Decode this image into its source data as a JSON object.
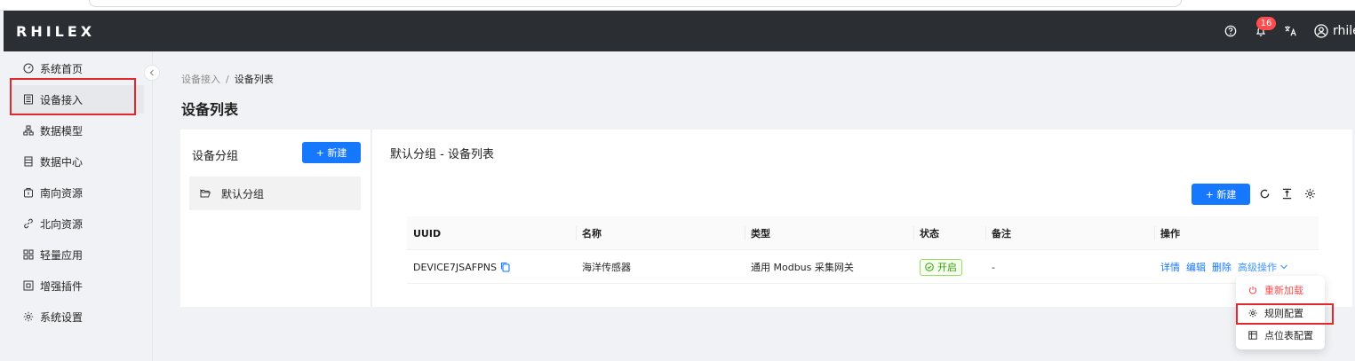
{
  "app": {
    "logo": "RHILEX",
    "notification_count": "16",
    "user": "rhile"
  },
  "sidebar": {
    "items": [
      {
        "label": "系统首页",
        "icon": "dashboard-icon"
      },
      {
        "label": "设备接入",
        "icon": "device-icon",
        "active": true
      },
      {
        "label": "数据模型",
        "icon": "model-icon"
      },
      {
        "label": "数据中心",
        "icon": "database-icon"
      },
      {
        "label": "南向资源",
        "icon": "south-resource-icon"
      },
      {
        "label": "北向资源",
        "icon": "north-resource-icon"
      },
      {
        "label": "轻量应用",
        "icon": "app-icon"
      },
      {
        "label": "增强插件",
        "icon": "plugin-icon"
      },
      {
        "label": "系统设置",
        "icon": "settings-icon"
      }
    ]
  },
  "breadcrumb": {
    "parent": "设备接入",
    "separator": "/",
    "current": "设备列表"
  },
  "page": {
    "title": "设备列表"
  },
  "groups": {
    "title": "设备分组",
    "new_label": "+ 新建",
    "items": [
      {
        "label": "默认分组"
      }
    ]
  },
  "list": {
    "title": "默认分组 - 设备列表",
    "new_label": "+ 新建",
    "columns": [
      "UUID",
      "名称",
      "类型",
      "状态",
      "备注",
      "操作"
    ],
    "rows": [
      {
        "uuid": "DEVICE7JSAFPNS",
        "name": "海洋传感器",
        "type": "通用 Modbus 采集网关",
        "state": "开启",
        "remark": "-",
        "actions": [
          "详情",
          "编辑",
          "删除"
        ],
        "advanced": "高级操作"
      }
    ]
  },
  "dropdown": {
    "items": [
      "重新加载",
      "规则配置",
      "点位表配置"
    ]
  },
  "colors": {
    "primary": "#1677ff",
    "topbar": "#2b2e33",
    "danger": "#ff4d4f",
    "success": "#389e0d",
    "highlight": "#e0282e"
  }
}
